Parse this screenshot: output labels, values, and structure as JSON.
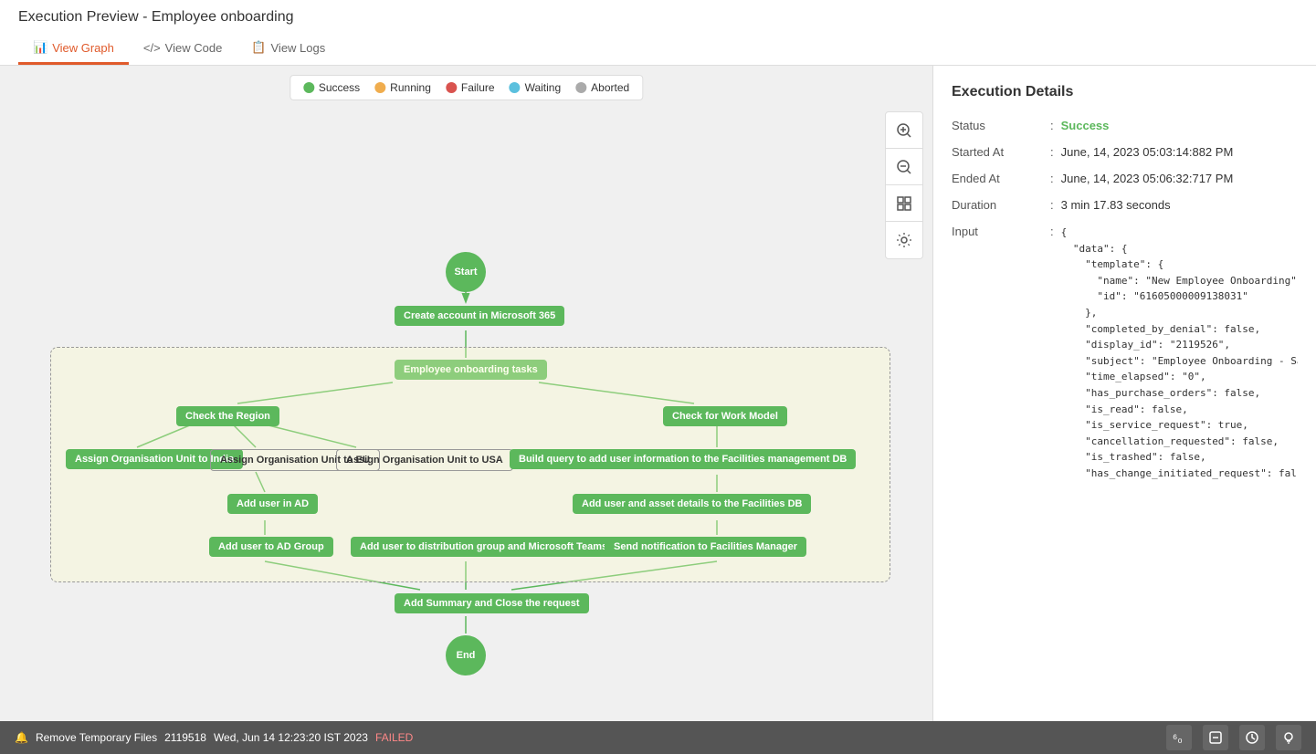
{
  "page": {
    "title": "Execution Preview - Employee onboarding"
  },
  "tabs": [
    {
      "id": "view-graph",
      "label": "View Graph",
      "icon": "📊",
      "active": true
    },
    {
      "id": "view-code",
      "label": "View Code",
      "icon": "</>"
    },
    {
      "id": "view-logs",
      "label": "View Logs",
      "icon": "📋"
    }
  ],
  "legend": [
    {
      "label": "Success",
      "color": "#5cb85c"
    },
    {
      "label": "Running",
      "color": "#f0ad4e"
    },
    {
      "label": "Failure",
      "color": "#d9534f"
    },
    {
      "label": "Waiting",
      "color": "#5bc0de"
    },
    {
      "label": "Aborted",
      "color": "#aaa"
    }
  ],
  "controls": [
    {
      "id": "zoom-in",
      "icon": "🔍+",
      "symbol": "⊕"
    },
    {
      "id": "zoom-out",
      "icon": "🔍-",
      "symbol": "⊖"
    },
    {
      "id": "grid",
      "icon": "⊞",
      "symbol": "⊞"
    },
    {
      "id": "settings",
      "icon": "⚙",
      "symbol": "⚙"
    }
  ],
  "nodes": {
    "start": "Start",
    "create_account": "Create account in Microsoft 365",
    "employee_onboarding": "Employee onboarding tasks",
    "check_region": "Check the Region",
    "check_work_model": "Check for Work Model",
    "assign_india": "Assign Organisation Unit to India",
    "assign_eu": "Assign Organisation Unit to EU",
    "assign_usa": "Assign Organisation Unit to USA",
    "build_query": "Build query to add user information to the Facilities management DB",
    "add_user_ad": "Add user in AD",
    "add_user_asset": "Add user and asset details to the Facilities DB",
    "add_user_ad_group": "Add user to AD Group",
    "add_distribution": "Add user to distribution group and Microsoft Teams channel",
    "send_notification": "Send notification to Facilities Manager",
    "add_summary": "Add Summary and Close the request",
    "end": "End"
  },
  "execution_details": {
    "title": "Execution Details",
    "status_label": "Status",
    "status_value": "Success",
    "started_at_label": "Started At",
    "started_at_value": "June, 14, 2023 05:03:14:882 PM",
    "ended_at_label": "Ended At",
    "ended_at_value": "June, 14, 2023 05:06:32:717 PM",
    "duration_label": "Duration",
    "duration_value": "3 min 17.83 seconds",
    "input_label": "Input",
    "input_json": "{\n  \"data\": {\n    \"template\": {\n      \"name\": \"New Employee Onboarding\",\n      \"id\": \"61605000009138031\"\n    },\n    \"completed_by_denial\": false,\n    \"display_id\": \"2119526\",\n    \"subject\": \"Employee Onboarding - Sangeetha Karunakaran\",\n    \"time_elapsed\": \"0\",\n    \"has_purchase_orders\": false,\n    \"is_read\": false,\n    \"is_service_request\": true,\n    \"cancellation_requested\": false,\n    \"is_trashed\": false,\n    \"has_change_initiated_request\": false"
  },
  "bottom_bar": {
    "icon": "🔔",
    "filename": "Remove Temporary Files",
    "id": "2119518",
    "timestamp": "Wed, Jun 14 12:23:20 IST 2023",
    "status": "FAILED"
  }
}
